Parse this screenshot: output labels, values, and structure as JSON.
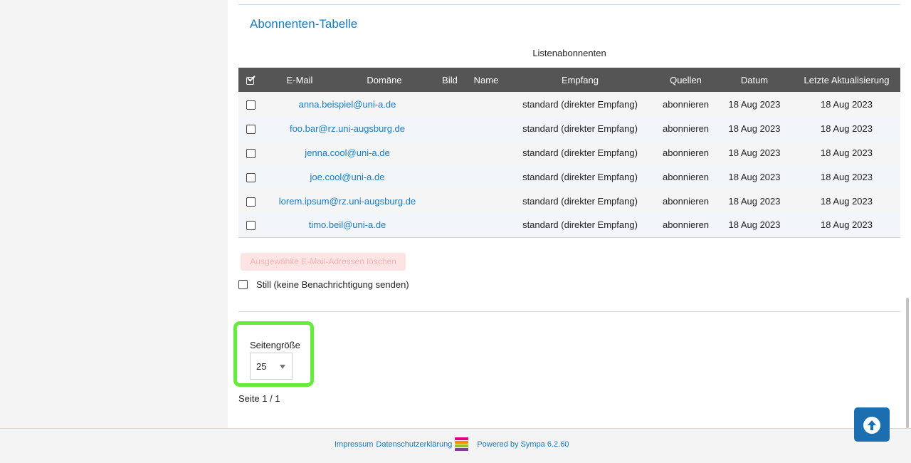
{
  "section": {
    "title": "Abonnenten-Tabelle",
    "caption": "Listenabonnenten"
  },
  "table": {
    "headers": [
      "E-Mail",
      "Domäne",
      "Bild",
      "Name",
      "Empfang",
      "Quellen",
      "Datum",
      "Letzte Aktualisierung"
    ],
    "rows": [
      {
        "email": "anna.beispiel@uni-a.de",
        "domain": "",
        "picture": "",
        "name": "",
        "reception": "standard (direkter Empfang)",
        "sources": "abonnieren",
        "date": "18 Aug 2023",
        "updated": "18 Aug 2023",
        "checked": false
      },
      {
        "email": "foo.bar@rz.uni-augsburg.de",
        "domain": "",
        "picture": "",
        "name": "",
        "reception": "standard (direkter Empfang)",
        "sources": "abonnieren",
        "date": "18 Aug 2023",
        "updated": "18 Aug 2023",
        "checked": false
      },
      {
        "email": "jenna.cool@uni-a.de",
        "domain": "",
        "picture": "",
        "name": "",
        "reception": "standard (direkter Empfang)",
        "sources": "abonnieren",
        "date": "18 Aug 2023",
        "updated": "18 Aug 2023",
        "checked": false
      },
      {
        "email": "joe.cool@uni-a.de",
        "domain": "",
        "picture": "",
        "name": "",
        "reception": "standard (direkter Empfang)",
        "sources": "abonnieren",
        "date": "18 Aug 2023",
        "updated": "18 Aug 2023",
        "checked": false
      },
      {
        "email": "lorem.ipsum@rz.uni-augsburg.de",
        "domain": "",
        "picture": "",
        "name": "",
        "reception": "standard (direkter Empfang)",
        "sources": "abonnieren",
        "date": "18 Aug 2023",
        "updated": "18 Aug 2023",
        "checked": false
      },
      {
        "email": "timo.beil@uni-a.de",
        "domain": "",
        "picture": "",
        "name": "",
        "reception": "standard (direkter Empfang)",
        "sources": "abonnieren",
        "date": "18 Aug 2023",
        "updated": "18 Aug 2023",
        "checked": false
      }
    ]
  },
  "actions": {
    "delete_label": "Ausgewählte E-Mail-Adressen löschen",
    "quiet_label": "Still (keine Benachrichtigung senden)"
  },
  "pagination": {
    "page_size_label": "Seitengröße",
    "page_size_value": "25",
    "page_info": "Seite 1 / 1"
  },
  "footer": {
    "impressum": "Impressum",
    "privacy": "Datenschutzerklärung",
    "powered_by": "Powered by Sympa 6.2.60"
  },
  "colors": {
    "link": "#1b7bbf",
    "table_header": "#555555",
    "highlight": "#64ec3c",
    "scroll_top_button": "#1b6fb0",
    "delete_button_bg": "#fde4e4",
    "sympa_logo": [
      "#e4007d",
      "#f29100",
      "#95c11f",
      "#7c3f98"
    ]
  },
  "icons": {
    "select_all": "check-square-icon",
    "scroll_top": "arrow-circle-up-icon",
    "page_size_dropdown": "caret-down-icon",
    "sympa_logo": "sympa-logo-icon"
  }
}
